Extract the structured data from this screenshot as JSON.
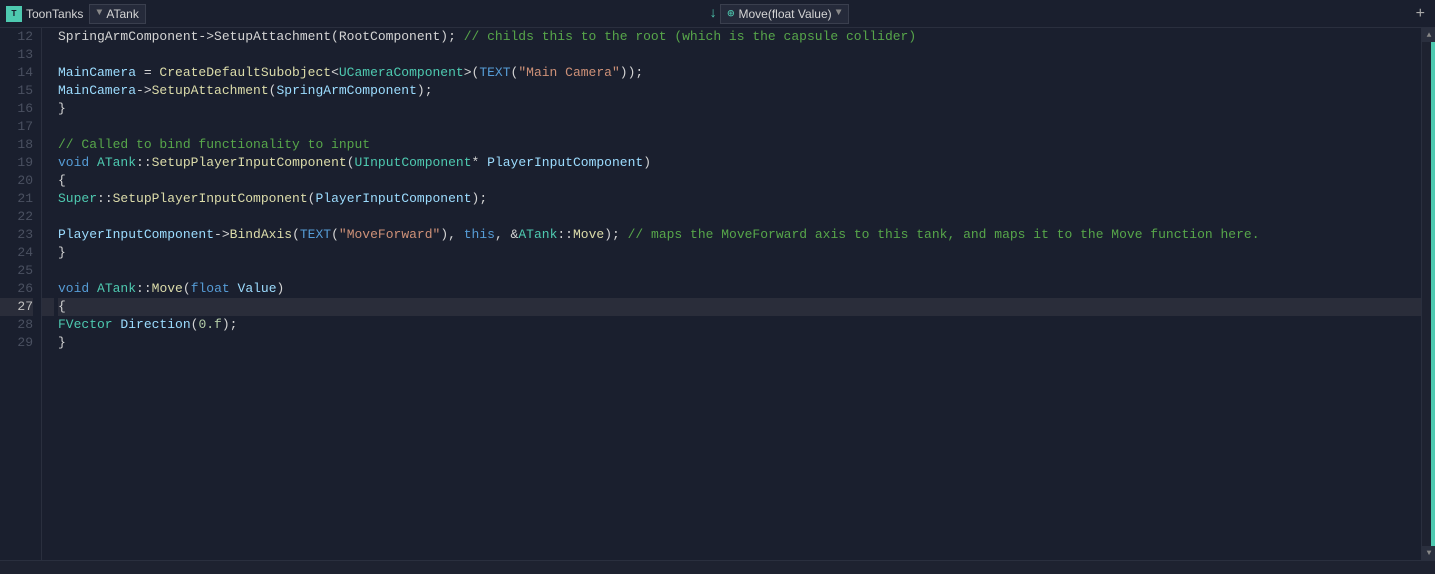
{
  "titlebar": {
    "project_icon": "T",
    "project_name": "ToonTanks",
    "file_dropdown": {
      "label": "ATank",
      "arrow": "▼"
    },
    "func_icon": "↓",
    "func_dropdown": {
      "label": "Move(float Value)",
      "arrow": "▼"
    },
    "add_btn": "+"
  },
  "lines": [
    {
      "num": 12,
      "active": false,
      "indent": 2,
      "tokens": [
        {
          "t": "SpringArmComponent->SetupAttachment(RootComponent);",
          "c": "plain"
        },
        {
          "t": " ",
          "c": "plain"
        },
        {
          "t": "// childs this to the root (which is the capsule collider)",
          "c": "cmt"
        }
      ]
    },
    {
      "num": 13,
      "active": false,
      "indent": 0,
      "tokens": []
    },
    {
      "num": 14,
      "active": false,
      "indent": 2,
      "tokens": [
        {
          "t": "MainCamera",
          "c": "var"
        },
        {
          "t": " = ",
          "c": "plain"
        },
        {
          "t": "CreateDefaultSubobject",
          "c": "fn"
        },
        {
          "t": "<",
          "c": "punc"
        },
        {
          "t": "UCameraComponent",
          "c": "type"
        },
        {
          "t": ">(",
          "c": "punc"
        },
        {
          "t": "TEXT",
          "c": "macro"
        },
        {
          "t": "(",
          "c": "punc"
        },
        {
          "t": "\"Main Camera\"",
          "c": "str"
        },
        {
          "t": "));",
          "c": "punc"
        }
      ]
    },
    {
      "num": 15,
      "active": false,
      "indent": 2,
      "tokens": [
        {
          "t": "MainCamera",
          "c": "var"
        },
        {
          "t": "->",
          "c": "plain"
        },
        {
          "t": "SetupAttachment",
          "c": "fn"
        },
        {
          "t": "(",
          "c": "punc"
        },
        {
          "t": "SpringArmComponent",
          "c": "var"
        },
        {
          "t": ");",
          "c": "punc"
        }
      ]
    },
    {
      "num": 16,
      "active": false,
      "indent": 1,
      "tokens": [
        {
          "t": "}",
          "c": "plain"
        }
      ]
    },
    {
      "num": 17,
      "active": false,
      "indent": 0,
      "tokens": []
    },
    {
      "num": 18,
      "active": false,
      "indent": 1,
      "tokens": [
        {
          "t": "// Called to bind functionality to input",
          "c": "cmt"
        }
      ]
    },
    {
      "num": 19,
      "active": false,
      "indent": 0,
      "tokens": [
        {
          "t": "void",
          "c": "kw"
        },
        {
          "t": " ",
          "c": "plain"
        },
        {
          "t": "ATank",
          "c": "type"
        },
        {
          "t": "::",
          "c": "plain"
        },
        {
          "t": "SetupPlayerInputComponent",
          "c": "fn"
        },
        {
          "t": "(",
          "c": "punc"
        },
        {
          "t": "UInputComponent",
          "c": "type"
        },
        {
          "t": "* ",
          "c": "plain"
        },
        {
          "t": "PlayerInputComponent",
          "c": "var"
        },
        {
          "t": ")",
          "c": "punc"
        }
      ]
    },
    {
      "num": 20,
      "active": false,
      "indent": 1,
      "tokens": [
        {
          "t": "{",
          "c": "plain"
        }
      ]
    },
    {
      "num": 21,
      "active": false,
      "indent": 2,
      "tokens": [
        {
          "t": "Super",
          "c": "type"
        },
        {
          "t": "::",
          "c": "plain"
        },
        {
          "t": "SetupPlayerInputComponent",
          "c": "fn"
        },
        {
          "t": "(",
          "c": "punc"
        },
        {
          "t": "PlayerInputComponent",
          "c": "var"
        },
        {
          "t": ");",
          "c": "punc"
        }
      ]
    },
    {
      "num": 22,
      "active": false,
      "indent": 0,
      "tokens": []
    },
    {
      "num": 23,
      "active": false,
      "indent": 2,
      "tokens": [
        {
          "t": "PlayerInputComponent",
          "c": "var"
        },
        {
          "t": "->",
          "c": "plain"
        },
        {
          "t": "BindAxis",
          "c": "fn"
        },
        {
          "t": "(",
          "c": "punc"
        },
        {
          "t": "TEXT",
          "c": "macro"
        },
        {
          "t": "(",
          "c": "punc"
        },
        {
          "t": "\"MoveForward\"",
          "c": "str"
        },
        {
          "t": "), ",
          "c": "punc"
        },
        {
          "t": "this",
          "c": "kw"
        },
        {
          "t": ", &",
          "c": "plain"
        },
        {
          "t": "ATank",
          "c": "type"
        },
        {
          "t": "::",
          "c": "plain"
        },
        {
          "t": "Move",
          "c": "fn"
        },
        {
          "t": ");",
          "c": "punc"
        },
        {
          "t": "  // maps the MoveForward axis to this tank, and maps it to the Move function here.",
          "c": "cmt"
        }
      ]
    },
    {
      "num": 24,
      "active": false,
      "indent": 1,
      "tokens": [
        {
          "t": "}",
          "c": "plain"
        }
      ]
    },
    {
      "num": 25,
      "active": false,
      "indent": 0,
      "tokens": []
    },
    {
      "num": 26,
      "active": false,
      "indent": 0,
      "tokens": [
        {
          "t": "void",
          "c": "kw"
        },
        {
          "t": " ",
          "c": "plain"
        },
        {
          "t": "ATank",
          "c": "type"
        },
        {
          "t": "::",
          "c": "plain"
        },
        {
          "t": "Move",
          "c": "fn"
        },
        {
          "t": "(",
          "c": "punc"
        },
        {
          "t": "float",
          "c": "kw"
        },
        {
          "t": " ",
          "c": "plain"
        },
        {
          "t": "Value",
          "c": "var"
        },
        {
          "t": ")",
          "c": "punc"
        }
      ]
    },
    {
      "num": 27,
      "active": true,
      "indent": 1,
      "tokens": [
        {
          "t": "{",
          "c": "plain"
        }
      ]
    },
    {
      "num": 28,
      "active": false,
      "indent": 2,
      "tokens": [
        {
          "t": "FVector",
          "c": "type"
        },
        {
          "t": " ",
          "c": "plain"
        },
        {
          "t": "Direction",
          "c": "var"
        },
        {
          "t": "(",
          "c": "punc"
        },
        {
          "t": "0.f",
          "c": "num"
        },
        {
          "t": ");",
          "c": "punc"
        }
      ]
    },
    {
      "num": 29,
      "active": false,
      "indent": 1,
      "tokens": [
        {
          "t": "}",
          "c": "plain"
        }
      ]
    }
  ],
  "colors": {
    "background": "#1a1f2e",
    "line_active": "#2a2d3a",
    "accent": "#4ec9b0",
    "scrollbar": "#3a3f4e"
  }
}
